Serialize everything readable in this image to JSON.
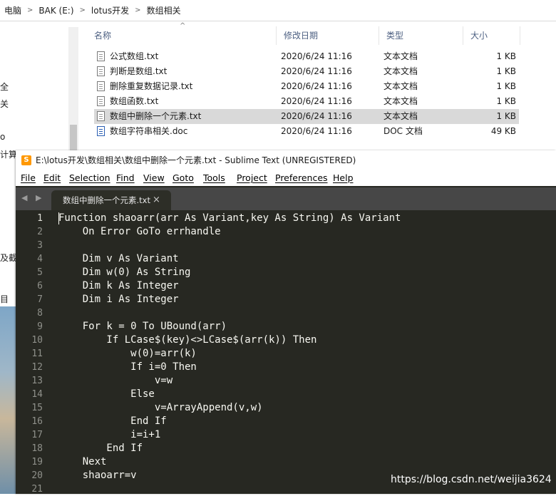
{
  "explorer": {
    "breadcrumb": [
      "电脑",
      "BAK (E:)",
      "lotus开发",
      "数组相关"
    ],
    "nav_fragments": [
      "全",
      "关",
      "o",
      "计算",
      "及截",
      "目"
    ],
    "columns": {
      "name": "名称",
      "modified": "修改日期",
      "type": "类型",
      "size": "大小"
    },
    "files": [
      {
        "name": "公式数组.txt",
        "modified": "2020/6/24 11:16",
        "type": "文本文档",
        "size": "1 KB",
        "icon": "text-file-icon"
      },
      {
        "name": "判断是数组.txt",
        "modified": "2020/6/24 11:16",
        "type": "文本文档",
        "size": "1 KB",
        "icon": "text-file-icon"
      },
      {
        "name": "删除重复数据记录.txt",
        "modified": "2020/6/24 11:16",
        "type": "文本文档",
        "size": "1 KB",
        "icon": "text-file-icon"
      },
      {
        "name": "数组函数.txt",
        "modified": "2020/6/24 11:16",
        "type": "文本文档",
        "size": "1 KB",
        "icon": "text-file-icon"
      },
      {
        "name": "数组中删除一个元素.txt",
        "modified": "2020/6/24 11:16",
        "type": "文本文档",
        "size": "1 KB",
        "icon": "text-file-icon",
        "selected": true
      },
      {
        "name": "数组字符串相关.doc",
        "modified": "2020/6/24 11:16",
        "type": "DOC 文档",
        "size": "49 KB",
        "icon": "word-doc-icon"
      }
    ]
  },
  "sublime": {
    "title": "E:\\lotus开发\\数组相关\\数组中删除一个元素.txt - Sublime Text (UNREGISTERED)",
    "menu": [
      "File",
      "Edit",
      "Selection",
      "Find",
      "View",
      "Goto",
      "Tools",
      "Project",
      "Preferences",
      "Help"
    ],
    "tab_label": "数组中删除一个元素.txt",
    "tab_close": "×",
    "tab_nav": "◀ ▶",
    "colors": {
      "editor_bg": "#272822",
      "text": "#f8f8f2",
      "gutter_text": "#8f908a",
      "tab_bar": "#474747"
    },
    "lines": [
      {
        "n": "1",
        "text": "Function shaoarr(arr As Variant,key As String) As Variant"
      },
      {
        "n": "2",
        "text": "    On Error GoTo errhandle"
      },
      {
        "n": "3",
        "text": ""
      },
      {
        "n": "4",
        "text": "    Dim v As Variant"
      },
      {
        "n": "5",
        "text": "    Dim w(0) As String"
      },
      {
        "n": "6",
        "text": "    Dim k As Integer"
      },
      {
        "n": "7",
        "text": "    Dim i As Integer"
      },
      {
        "n": "8",
        "text": ""
      },
      {
        "n": "9",
        "text": "    For k = 0 To UBound(arr)"
      },
      {
        "n": "10",
        "text": "        If LCase$(key)<>LCase$(arr(k)) Then"
      },
      {
        "n": "11",
        "text": "            w(0)=arr(k)"
      },
      {
        "n": "12",
        "text": "            If i=0 Then"
      },
      {
        "n": "13",
        "text": "                v=w"
      },
      {
        "n": "14",
        "text": "            Else"
      },
      {
        "n": "15",
        "text": "                v=ArrayAppend(v,w)"
      },
      {
        "n": "16",
        "text": "            End If"
      },
      {
        "n": "17",
        "text": "            i=i+1"
      },
      {
        "n": "18",
        "text": "        End If"
      },
      {
        "n": "19",
        "text": "    Next"
      },
      {
        "n": "20",
        "text": "    shaoarr=v"
      },
      {
        "n": "21",
        "text": ""
      }
    ]
  },
  "watermark": "https://blog.csdn.net/weijia3624"
}
